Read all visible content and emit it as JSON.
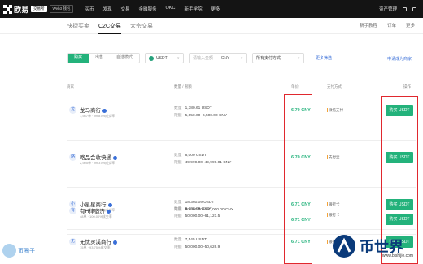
{
  "brand": {
    "name": "欧易",
    "pill1": "交易所",
    "pill2": "Web3 钱包"
  },
  "topnav": [
    "买币",
    "发现",
    "交易",
    "金融服务",
    "OKC",
    "新手学院",
    "更多"
  ],
  "topright": {
    "asset": "资产管理"
  },
  "subnav": {
    "tabs": [
      "快捷买卖",
      "C2C交易",
      "大宗交易"
    ],
    "right": [
      "新手教程",
      "订单",
      "更多"
    ]
  },
  "filters": {
    "buy": "购买",
    "sell": "出售",
    "mode": "自选模式",
    "coin": "USDT",
    "amount_placeholder": "请输入金额",
    "currency": "CNY",
    "payment": "所有支付方式",
    "more": "更多筛选",
    "apply": "申请成为商家"
  },
  "table": {
    "headers": {
      "merchant": "商家",
      "qty": "数量 / 限额",
      "price": "单价",
      "payment": "支付方式",
      "action": "操作"
    }
  },
  "rows": [
    {
      "avatar": "龙",
      "name": "龙马商行",
      "stats": "1,567单 · 99.87%成交率",
      "qty": "1,380.61 USDT",
      "limit": "5,050.00–6,500.00 CNY",
      "price": "6.70 CNY",
      "pay": "微信支付",
      "btn": "购买 USDT"
    },
    {
      "avatar": "略",
      "name": "略品会收快通",
      "stats": "2,505单 · 99.37%成交率",
      "qty": "8,000 USDT",
      "limit": "49,999.00–49,999.01 CNY",
      "price": "6.70 CNY",
      "pay": "支付宝",
      "btn": "购买 USDT"
    },
    {
      "avatar": "小",
      "name": "小星星商行",
      "stats": "9,794单 · 99.66%成交率",
      "qty": "18,360.09 USDT",
      "limit": "60,000.00–120,000.00 CNY",
      "price": "6.71 CNY",
      "pay": "银行卡",
      "btn": "购买 USDT"
    },
    {
      "avatar": "有",
      "name": "有H律宿济",
      "stats": "48单 · 100.00%成交率",
      "qty": "9,108.99 USDT",
      "limit": "50,000.00–61,121.5",
      "price": "6.71 CNY",
      "pay": "银行卡",
      "btn": "购买 USDT"
    },
    {
      "avatar": "无",
      "name": "无忧灵溪商行",
      "stats": "15单 · 93.75%成交率",
      "qty": "7,545 USDT",
      "limit": "50,000.00–50,626.9",
      "price": "6.71 CNY",
      "pay": "银行卡",
      "btn": "购买 USDT"
    }
  ],
  "labels": {
    "qty": "数量",
    "limit": "限额"
  },
  "watermark": {
    "left": "币圈子",
    "right": "币世界",
    "url": "www.bishijie.com"
  },
  "colors": {
    "green": "#23b27b",
    "highlight": "#e0282e",
    "blue": "#3a6fd8"
  }
}
